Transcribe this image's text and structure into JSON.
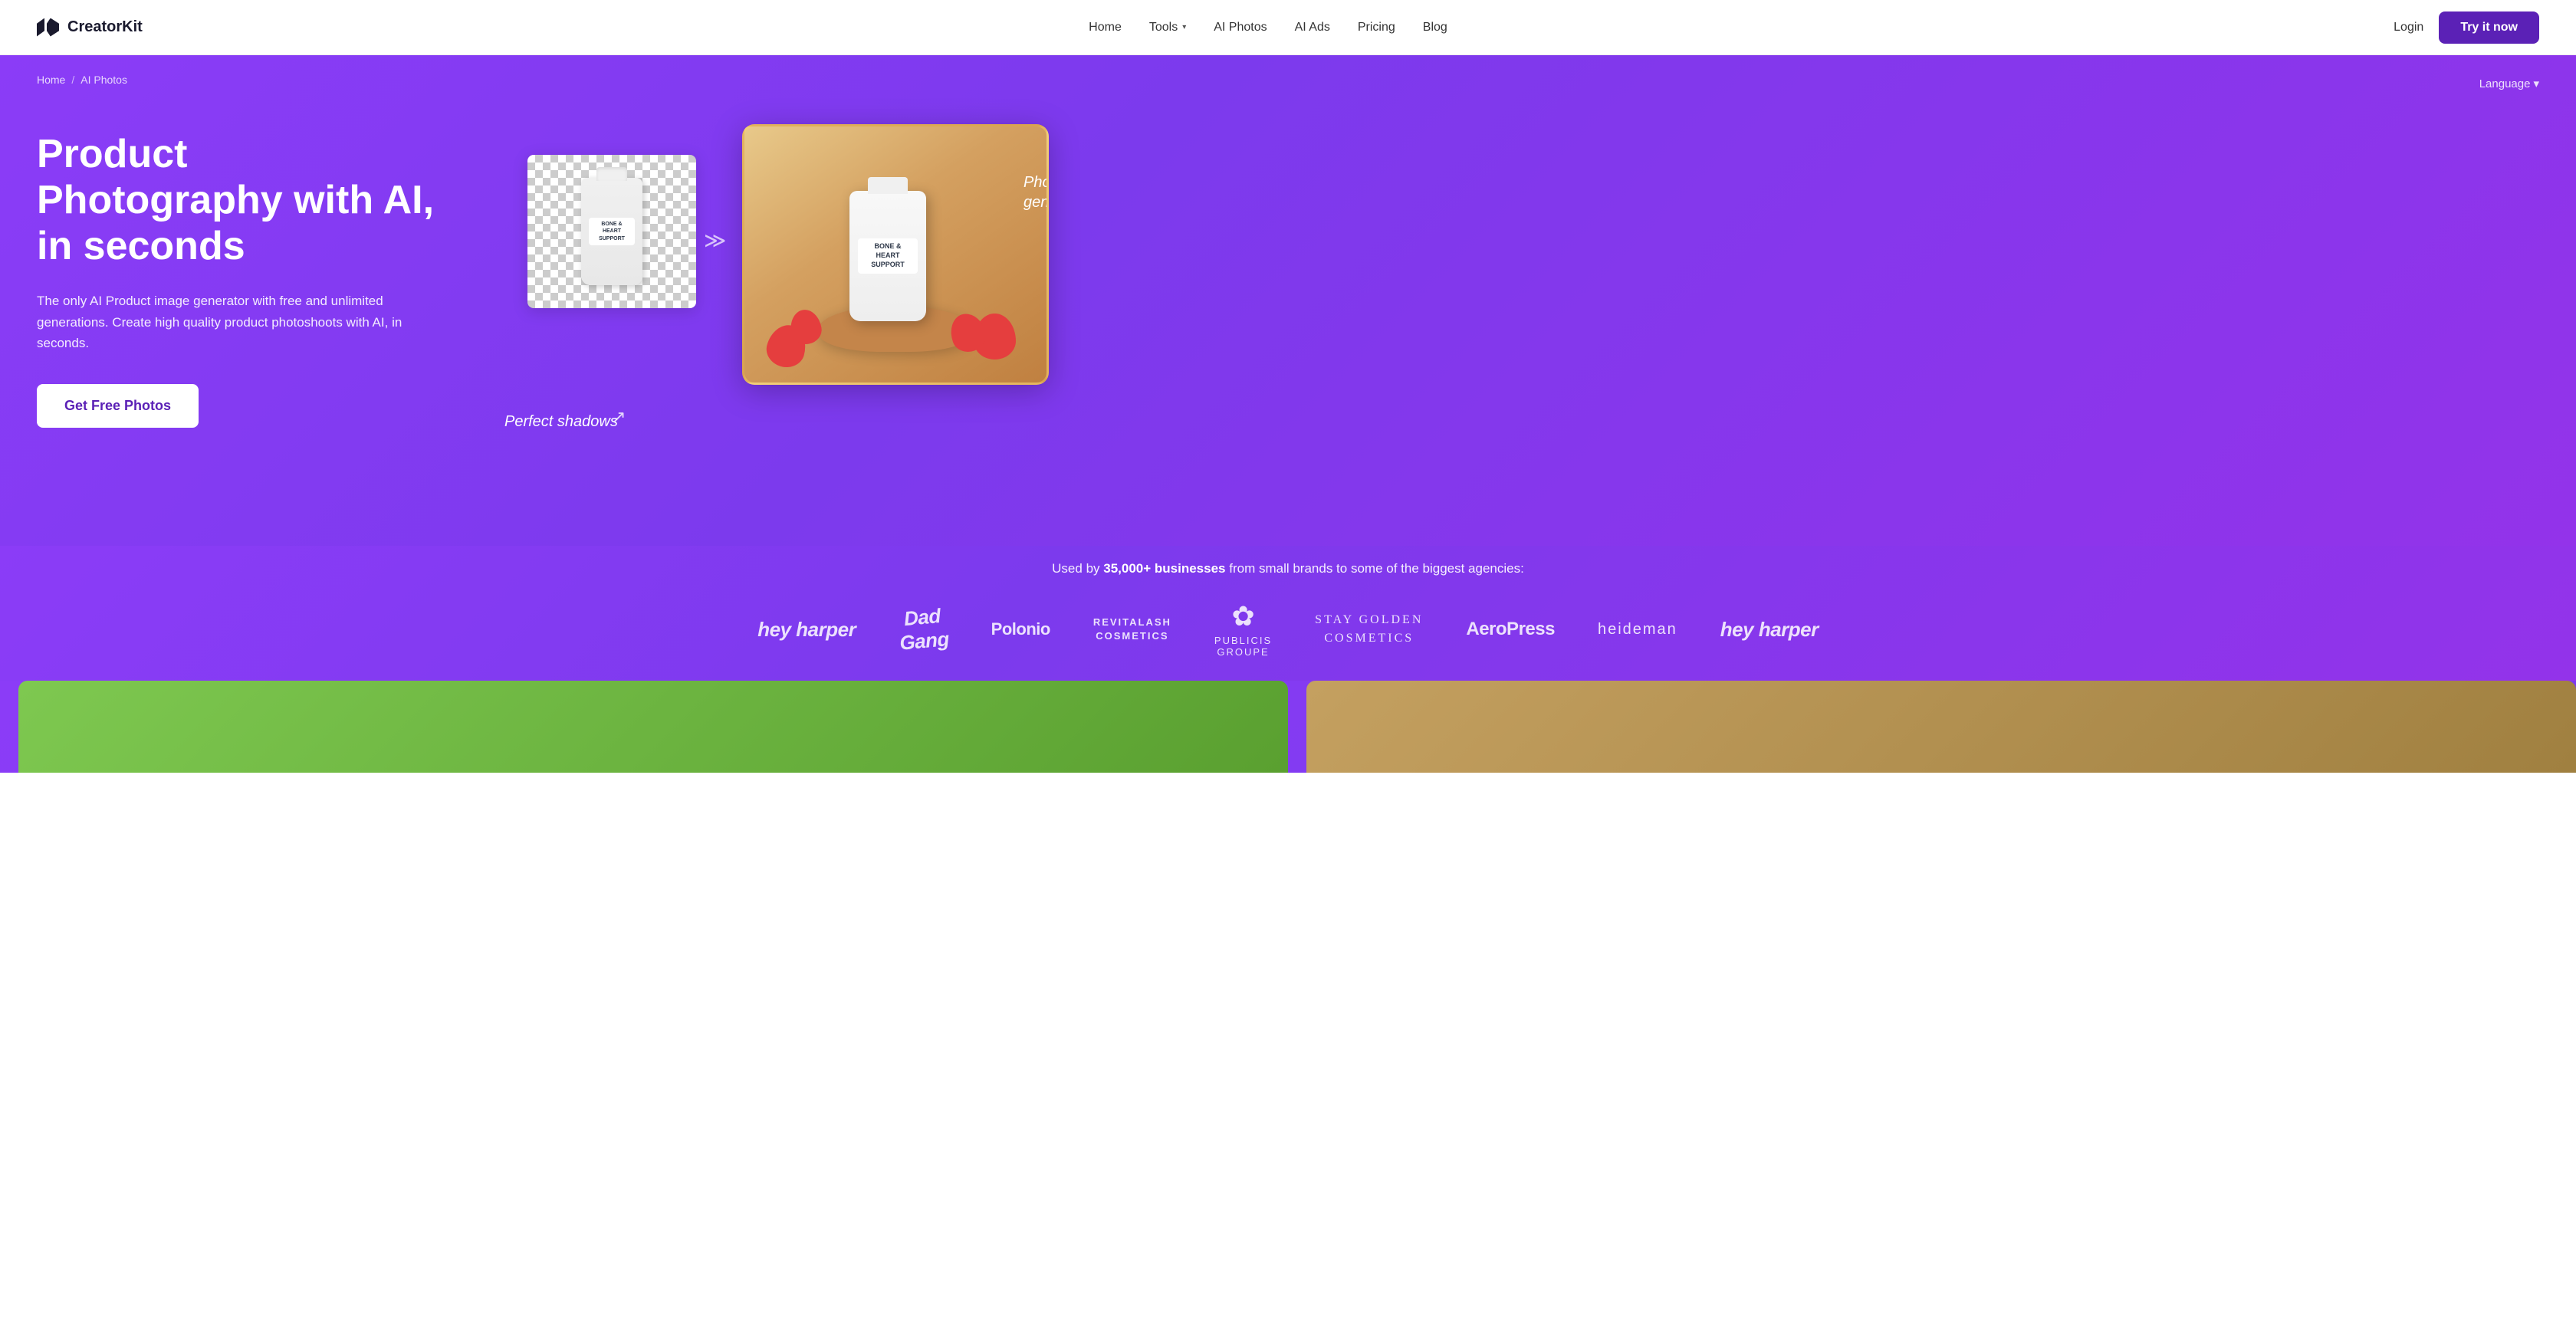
{
  "navbar": {
    "logo_text": "CreatorKit",
    "nav_items": [
      {
        "label": "Home",
        "id": "home"
      },
      {
        "label": "Tools",
        "id": "tools",
        "has_dropdown": true
      },
      {
        "label": "AI Photos",
        "id": "ai-photos"
      },
      {
        "label": "AI Ads",
        "id": "ai-ads"
      },
      {
        "label": "Pricing",
        "id": "pricing"
      },
      {
        "label": "Blog",
        "id": "blog"
      }
    ],
    "login_label": "Login",
    "try_label": "Try it now"
  },
  "breadcrumb": {
    "home_label": "Home",
    "separator": "/",
    "current_label": "AI Photos"
  },
  "language": {
    "label": "Language"
  },
  "hero": {
    "title": "Product Photography with AI, in seconds",
    "subtitle": "The only AI Product image generator with free and unlimited generations. Create high quality product photoshoots with AI, in seconds.",
    "cta_label": "Get Free Photos",
    "annotation_photorealistic": "Photorealistic generations",
    "annotation_shadows": "Perfect shadows"
  },
  "social_proof": {
    "text_normal": "Used by ",
    "text_bold": "35,000+ businesses",
    "text_suffix": " from small brands to some of the biggest agencies:",
    "brands": [
      {
        "label": "hey harper",
        "style": "script"
      },
      {
        "label": "Dad Gang",
        "style": "dadgang"
      },
      {
        "label": "Polonio",
        "style": "bold"
      },
      {
        "label": "REVITALASH\nCOSMETICS",
        "style": "condensed"
      },
      {
        "label": "PUBLICIS\nGROUPE",
        "style": "flower"
      },
      {
        "label": "STAY GOLDEN\nCOSMETICS",
        "style": "serif"
      },
      {
        "label": "AeroPress",
        "style": "aero"
      },
      {
        "label": "heideman",
        "style": "light"
      },
      {
        "label": "hey harper",
        "style": "script2"
      }
    ]
  },
  "product_bottle_before": {
    "cap": "",
    "line1": "BONE &",
    "line2": "HEART",
    "line3": "SUPPORT"
  },
  "product_bottle_after": {
    "cap": "",
    "line1": "BONE &",
    "line2": "HEART",
    "line3": "SUPPORT"
  }
}
